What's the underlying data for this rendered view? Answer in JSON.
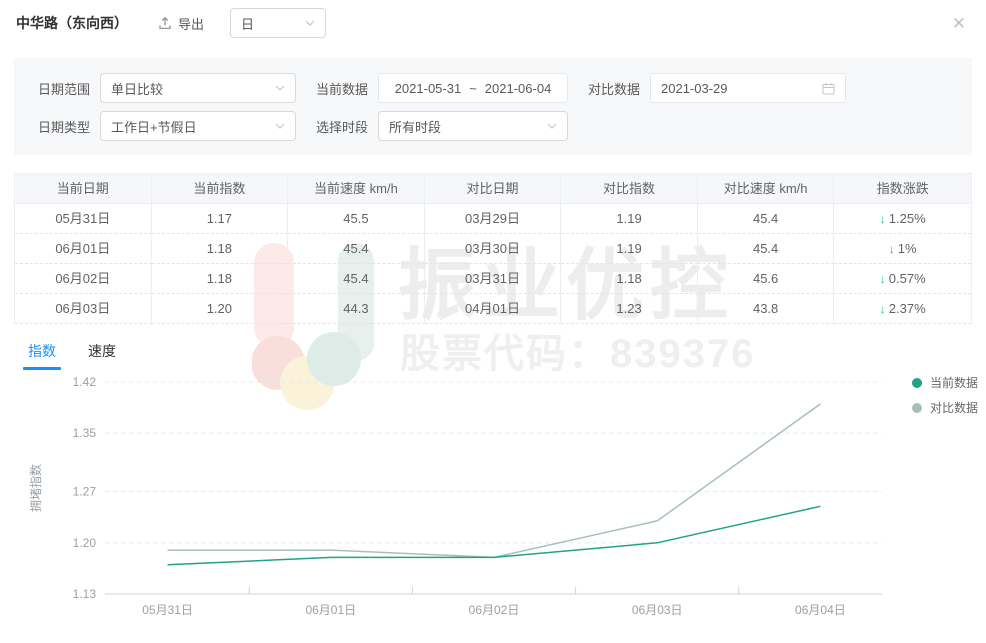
{
  "header": {
    "title": "中华路（东向西）",
    "export_label": "导出",
    "granularity": "日"
  },
  "filters": {
    "date_range": {
      "label": "日期范围",
      "value": "单日比较"
    },
    "current_data": {
      "label": "当前数据",
      "start": "2021-05-31",
      "separator": "~",
      "end": "2021-06-04"
    },
    "compare_data": {
      "label": "对比数据",
      "value": "2021-03-29"
    },
    "date_type": {
      "label": "日期类型",
      "value": "工作日+节假日"
    },
    "time_period": {
      "label": "选择时段",
      "value": "所有时段"
    }
  },
  "table": {
    "headers": [
      "当前日期",
      "当前指数",
      "当前速度 km/h",
      "对比日期",
      "对比指数",
      "对比速度 km/h",
      "指数涨跌"
    ],
    "rows": [
      {
        "cells": [
          "05月31日",
          "1.17",
          "45.5",
          "03月29日",
          "1.19",
          "45.4"
        ],
        "change": "1.25%",
        "direction": "down"
      },
      {
        "cells": [
          "06月01日",
          "1.18",
          "45.4",
          "03月30日",
          "1.19",
          "45.4"
        ],
        "change": "1%",
        "direction": "down"
      },
      {
        "cells": [
          "06月02日",
          "1.18",
          "45.4",
          "03月31日",
          "1.18",
          "45.6"
        ],
        "change": "0.57%",
        "direction": "down"
      },
      {
        "cells": [
          "06月03日",
          "1.20",
          "44.3",
          "04月01日",
          "1.23",
          "43.8"
        ],
        "change": "2.37%",
        "direction": "down"
      }
    ]
  },
  "tabs": [
    {
      "label": "指数",
      "active": true
    },
    {
      "label": "速度",
      "active": false
    }
  ],
  "watermark": {
    "brand": "振业优控",
    "stock_label": "股票代码：839376"
  },
  "icons": {
    "down_arrow": "↓",
    "close": "✕"
  },
  "colors": {
    "accent_teal": "#2cb5a3",
    "tab_active": "#1890ff"
  },
  "chart_data": {
    "type": "line",
    "x": [
      "05月31日",
      "06月01日",
      "06月02日",
      "06月03日",
      "06月04日"
    ],
    "series": [
      {
        "name": "当前数据",
        "color": "#20a287",
        "values": [
          1.17,
          1.18,
          1.18,
          1.2,
          1.25
        ]
      },
      {
        "name": "对比数据",
        "color": "#a6c0b7",
        "values": [
          1.19,
          1.19,
          1.18,
          1.23,
          1.39
        ]
      }
    ],
    "ylabel": "拥堵指数",
    "yticks": [
      1.13,
      1.2,
      1.27,
      1.35,
      1.42
    ],
    "ylim": [
      1.13,
      1.42
    ],
    "grid": "dashed-horizontal",
    "legend_position": "top-right"
  }
}
